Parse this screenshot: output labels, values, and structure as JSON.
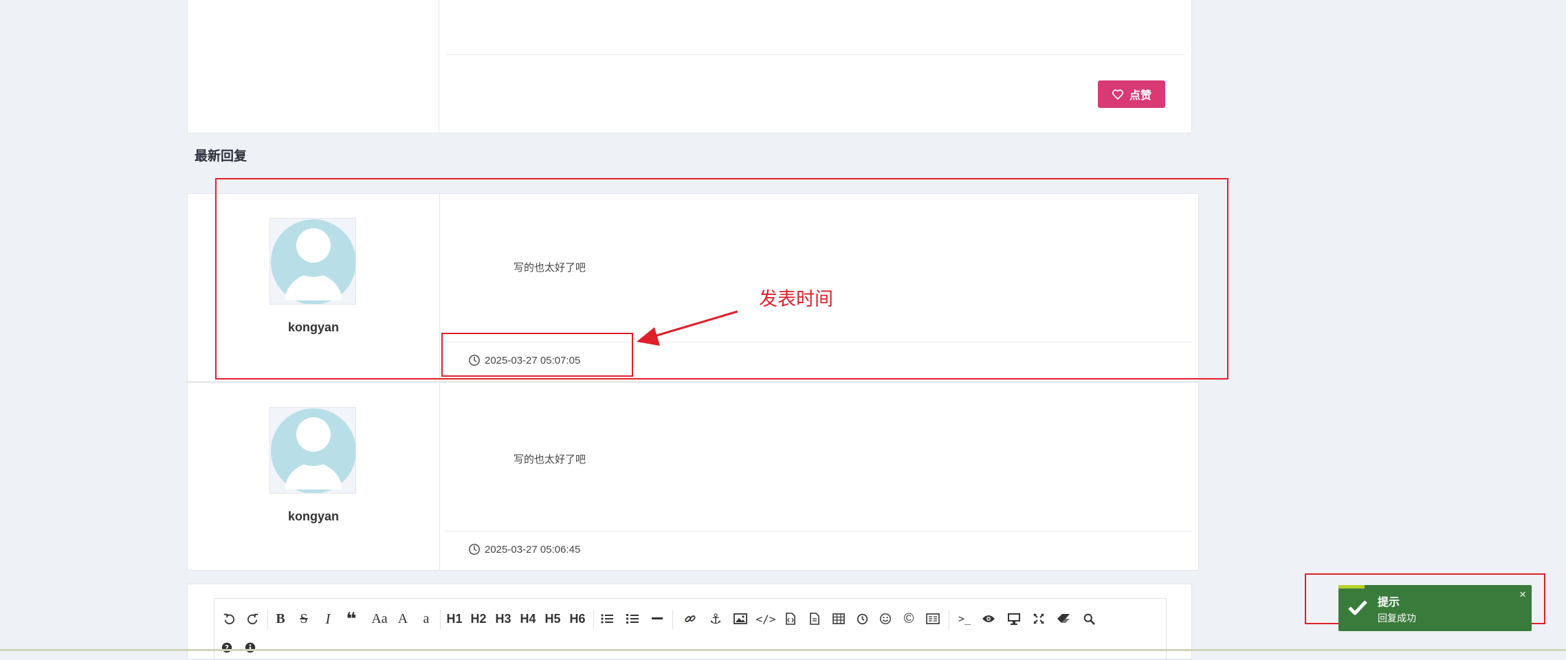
{
  "top_post": {
    "like_label": "点赞"
  },
  "section": {
    "title": "最新回复"
  },
  "replies": [
    {
      "username": "kongyan",
      "content": "写的也太好了吧",
      "time": "2025-03-27 05:07:05"
    },
    {
      "username": "kongyan",
      "content": "写的也太好了吧",
      "time": "2025-03-27 05:06:45"
    }
  ],
  "annotation": {
    "label": "发表时间"
  },
  "editor": {
    "toolbar": [
      "undo-icon",
      "redo-icon",
      "bold-icon",
      "strikethrough-icon",
      "italic-icon",
      "quote-icon",
      "uppercase-icon",
      "uppercase-first-icon",
      "lowercase-icon",
      "h1",
      "h2",
      "h3",
      "h4",
      "h5",
      "h6",
      "unordered-list-icon",
      "ordered-list-icon",
      "horizontal-rule-icon",
      "link-icon",
      "anchor-icon",
      "image-icon",
      "code-icon",
      "preformatted-code-icon",
      "code-block-icon",
      "table-icon",
      "datetime-icon",
      "emoji-icon",
      "html-entities-icon",
      "pagebreak-icon",
      "terminal-icon",
      "preview-icon",
      "fullscreen-preview-icon",
      "fullscreen-icon",
      "clear-icon",
      "search-icon",
      "help-icon",
      "info-icon"
    ],
    "headings": {
      "h1": "H1",
      "h2": "H2",
      "h3": "H3",
      "h4": "H4",
      "h5": "H5",
      "h6": "H6"
    },
    "glyphs": {
      "bold": "B",
      "strike": "S",
      "italic": "I",
      "upper": "Aa",
      "upper_first": "A",
      "lower": "a",
      "terminal": ">_"
    }
  },
  "toast": {
    "title": "提示",
    "message": "回复成功",
    "close": "×"
  },
  "colors": {
    "like_button": "#d93a74",
    "toast_bg": "#387b3b",
    "annotation_red": "#e01f2a",
    "avatar": "#b8dfe8"
  }
}
